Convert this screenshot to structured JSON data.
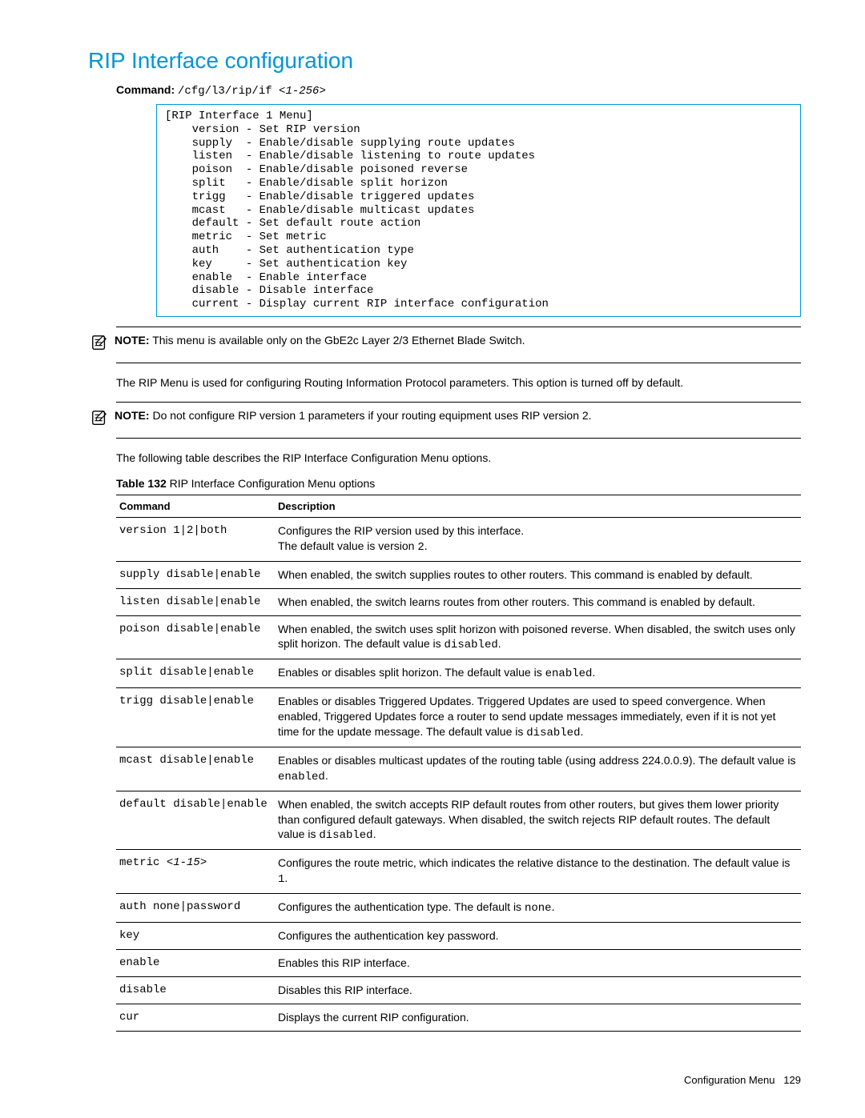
{
  "title": "RIP Interface configuration",
  "command_label": "Command:",
  "command_path": "/cfg/l3/rip/if ",
  "command_arg": "<1-256>",
  "menu_header": "[RIP Interface 1 Menu]",
  "menu_items": [
    {
      "k": "version",
      "d": "Set RIP version"
    },
    {
      "k": "supply",
      "d": "Enable/disable supplying route updates"
    },
    {
      "k": "listen",
      "d": "Enable/disable listening to route updates"
    },
    {
      "k": "poison",
      "d": "Enable/disable poisoned reverse"
    },
    {
      "k": "split",
      "d": "Enable/disable split horizon"
    },
    {
      "k": "trigg",
      "d": "Enable/disable triggered updates"
    },
    {
      "k": "mcast",
      "d": "Enable/disable multicast updates"
    },
    {
      "k": "default",
      "d": "Set default route action"
    },
    {
      "k": "metric",
      "d": "Set metric"
    },
    {
      "k": "auth",
      "d": "Set authentication type"
    },
    {
      "k": "key",
      "d": "Set authentication key"
    },
    {
      "k": "enable",
      "d": "Enable interface"
    },
    {
      "k": "disable",
      "d": "Disable interface"
    },
    {
      "k": "current",
      "d": "Display current RIP interface configuration"
    }
  ],
  "note_label": "NOTE:",
  "note1_text": "This menu is available only on the GbE2c Layer 2/3 Ethernet Blade Switch.",
  "para1": "The RIP Menu is used for configuring Routing Information Protocol parameters. This option is turned off by default.",
  "note2_text": "Do not configure RIP version 1 parameters if your routing equipment uses RIP version 2.",
  "para2": "The following table describes the RIP Interface Configuration Menu options.",
  "table_label": "Table 132",
  "table_caption": "RIP Interface Configuration Menu options",
  "th_command": "Command",
  "th_description": "Description",
  "rows": [
    {
      "cmd": "version 1|2|both",
      "desc_pre": "Configures the RIP version used by this interface.\nThe default value is version ",
      "mono": "2",
      "desc_post": "."
    },
    {
      "cmd": "supply disable|enable",
      "desc_pre": "When enabled, the switch supplies routes to other routers. This command is enabled by default.",
      "mono": "",
      "desc_post": ""
    },
    {
      "cmd": "listen disable|enable",
      "desc_pre": "When enabled, the switch learns routes from other routers. This command is enabled by default.",
      "mono": "",
      "desc_post": ""
    },
    {
      "cmd": "poison disable|enable",
      "desc_pre": "When enabled, the switch uses split horizon with poisoned reverse. When disabled, the switch uses only split horizon. The default value is ",
      "mono": "disabled",
      "desc_post": "."
    },
    {
      "cmd": "split disable|enable",
      "desc_pre": "Enables or disables split horizon. The default value is ",
      "mono": "enabled",
      "desc_post": "."
    },
    {
      "cmd": "trigg disable|enable",
      "desc_pre": "Enables or disables Triggered Updates. Triggered Updates are used to speed convergence. When enabled, Triggered Updates force a router to send update messages immediately, even if it is not yet time for the update message. The default value is ",
      "mono": "disabled",
      "desc_post": "."
    },
    {
      "cmd": "mcast disable|enable",
      "desc_pre": "Enables or disables multicast updates of the routing table (using address 224.0.0.9). The default value is ",
      "mono": "enabled",
      "desc_post": "."
    },
    {
      "cmd": "default disable|enable",
      "desc_pre": "When enabled, the switch accepts RIP default routes from other routers, but gives them lower priority than configured default gateways. When disabled, the switch rejects RIP default routes. The default value is ",
      "mono": "disabled",
      "desc_post": "."
    },
    {
      "cmd": "metric ",
      "cmd_arg": "<1-15>",
      "desc_pre": "Configures the route metric, which indicates the relative distance to the destination. The default value is ",
      "mono": "1",
      "desc_post": "."
    },
    {
      "cmd": "auth none|password",
      "desc_pre": "Configures the authentication type. The default is ",
      "mono": "none",
      "desc_post": "."
    },
    {
      "cmd": "key",
      "desc_pre": "Configures the authentication key password.",
      "mono": "",
      "desc_post": ""
    },
    {
      "cmd": "enable",
      "desc_pre": "Enables this RIP interface.",
      "mono": "",
      "desc_post": ""
    },
    {
      "cmd": "disable",
      "desc_pre": "Disables this RIP interface.",
      "mono": "",
      "desc_post": ""
    },
    {
      "cmd": "cur",
      "desc_pre": "Displays the current RIP configuration.",
      "mono": "",
      "desc_post": ""
    }
  ],
  "footer_section": "Configuration Menu",
  "footer_page": "129"
}
